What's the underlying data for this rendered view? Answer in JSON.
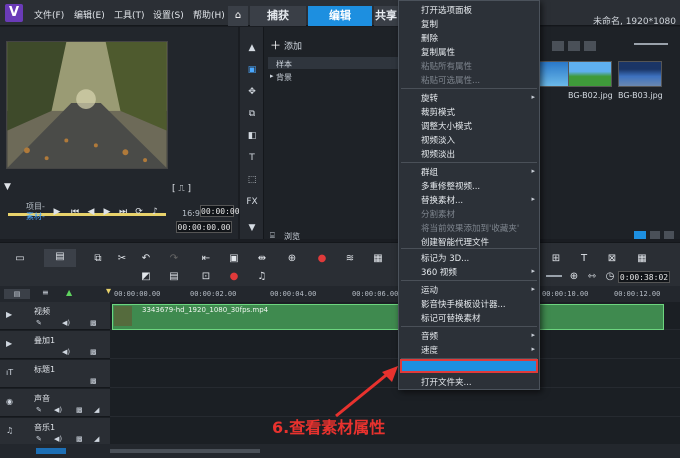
{
  "titlebar": {
    "menu": [
      "文件(F)",
      "编辑(E)",
      "工具(T)",
      "设置(S)",
      "帮助(H)"
    ],
    "tabs": [
      "捕获",
      "编辑",
      "共享"
    ],
    "active_tab": "编辑",
    "window_info": "未命名, 1920*1080"
  },
  "player": {
    "mode_project": "项目-",
    "mode_clip": "素材-",
    "timecode_1": "00:00:00.00",
    "timecode_2": "00:00:00.00",
    "ratio": "16:9"
  },
  "library": {
    "add_label": "添加",
    "folders": [
      "样本",
      "背景"
    ],
    "browse_label": "浏览",
    "thumbnails": [
      "BG-B02.jpg",
      "BG-B03.jpg"
    ]
  },
  "timeline": {
    "ruler": [
      "00:00:00.00",
      "00:00:02.00",
      "00:00:04.00",
      "00:00:06.00",
      "00:00:10.00",
      "00:00:12.00"
    ],
    "total_time": "0:00:38:02",
    "tracks": [
      "视频",
      "叠加1",
      "标题1",
      "声音",
      "音乐1"
    ],
    "clip_name": "3343679-hd_1920_1080_30fps.mp4"
  },
  "context_menu": {
    "items": [
      {
        "label": "打开选项面板",
        "disabled": false,
        "submenu": false
      },
      {
        "label": "复制",
        "disabled": false,
        "submenu": false
      },
      {
        "label": "删除",
        "disabled": false,
        "submenu": false
      },
      {
        "label": "复制属性",
        "disabled": false,
        "submenu": false
      },
      {
        "label": "粘贴所有属性",
        "disabled": true,
        "submenu": false
      },
      {
        "label": "粘贴可选属性...",
        "disabled": true,
        "submenu": false
      },
      {
        "label": "旋转",
        "disabled": false,
        "submenu": true
      },
      {
        "label": "裁剪模式",
        "disabled": false,
        "submenu": false
      },
      {
        "label": "调整大小模式",
        "disabled": false,
        "submenu": false
      },
      {
        "label": "视频淡入",
        "disabled": false,
        "submenu": false
      },
      {
        "label": "视频淡出",
        "disabled": false,
        "submenu": false
      },
      {
        "label": "群组",
        "disabled": false,
        "submenu": true
      },
      {
        "label": "多重修整视频...",
        "disabled": false,
        "submenu": false
      },
      {
        "label": "替换素材...",
        "disabled": false,
        "submenu": true
      },
      {
        "label": "分割素材",
        "disabled": true,
        "submenu": false
      },
      {
        "label": "将当前效果添加到'收藏夹'",
        "disabled": true,
        "submenu": false
      },
      {
        "label": "创建智能代理文件",
        "disabled": false,
        "submenu": false
      },
      {
        "label": "标记为 3D...",
        "disabled": false,
        "submenu": false
      },
      {
        "label": "360 视频",
        "disabled": false,
        "submenu": true
      },
      {
        "label": "运动",
        "disabled": false,
        "submenu": true
      },
      {
        "label": "影音快手模板设计器...",
        "disabled": false,
        "submenu": false
      },
      {
        "label": "标记可替换素材",
        "disabled": false,
        "submenu": false
      },
      {
        "label": "音频",
        "disabled": false,
        "submenu": true
      },
      {
        "label": "速度",
        "disabled": false,
        "submenu": true
      },
      {
        "label": "属性...",
        "disabled": false,
        "submenu": false
      },
      {
        "label": "打开文件夹...",
        "disabled": false,
        "submenu": false
      }
    ]
  },
  "annotation": "6.查看素材属性",
  "colors": {
    "accent": "#1d8fe0",
    "annotation": "#e8322e",
    "clip": "#3f8a4f"
  }
}
